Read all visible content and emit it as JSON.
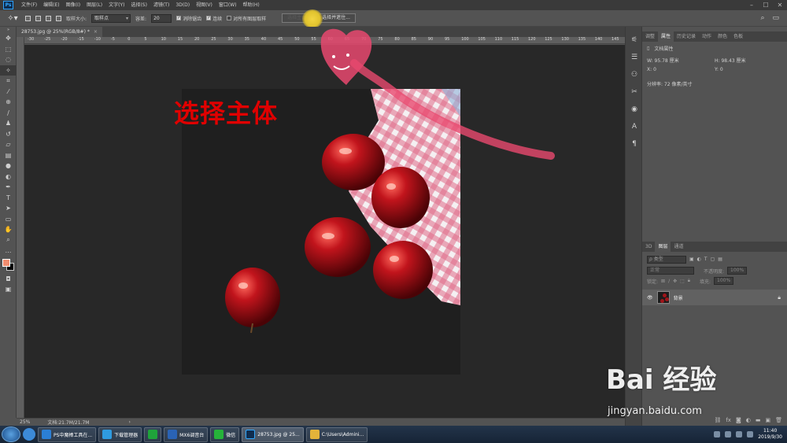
{
  "menubar": {
    "app_badge": "Ps",
    "items": [
      "文件(F)",
      "编辑(E)",
      "图像(I)",
      "图层(L)",
      "文字(Y)",
      "选择(S)",
      "滤镜(T)",
      "3D(D)",
      "视图(V)",
      "窗口(W)",
      "帮助(H)"
    ],
    "window_controls": [
      "–",
      "☐",
      "✕"
    ]
  },
  "options": {
    "sample_size_label": "取样大小:",
    "sample_size_value": "取样点",
    "tolerance_label": "容差:",
    "tolerance_value": "20",
    "antialias_label": "消除锯齿",
    "contiguous_label": "连续",
    "sample_all_label": "对所有图层取样",
    "select_subject_label": "选择主体",
    "select_mask_label": "选择并遮住..."
  },
  "document": {
    "tab_title": "28753.jpg @ 25%(RGB/8#) *",
    "close_symbol": "×",
    "ruler_ticks": [
      "-30",
      "-25",
      "-20",
      "-15",
      "-10",
      "-5",
      "0",
      "5",
      "10",
      "15",
      "20",
      "25",
      "30",
      "35",
      "40",
      "45",
      "50",
      "55",
      "60",
      "65",
      "70",
      "75",
      "80",
      "85",
      "90",
      "95",
      "100",
      "105",
      "110",
      "115",
      "120",
      "125",
      "130",
      "135",
      "140",
      "145"
    ],
    "overlay_text": "选择主体"
  },
  "status": {
    "zoom": "25%",
    "doc_info": "文档:21.7M/21.7M",
    "arrow": "›"
  },
  "properties_panel": {
    "tabs": [
      "调整",
      "属性",
      "历史记录",
      "动作",
      "颜色",
      "色板"
    ],
    "active_tab": "属性",
    "section_title": "文档属性",
    "w_label": "W:",
    "w_value": "95.78 厘米",
    "h_label": "H:",
    "h_value": "98.43 厘米",
    "x_label": "X:",
    "x_value": "0",
    "y_label": "Y:",
    "y_value": "0",
    "resolution": "分辨率: 72 像素/英寸"
  },
  "layers_panel": {
    "tabs": [
      "3D",
      "图层",
      "通道"
    ],
    "active_tab": "图层",
    "filter_placeholder": "ρ 类型",
    "blend_mode": "正常",
    "opacity_label": "不透明度:",
    "opacity_value": "100%",
    "lock_label": "锁定:",
    "fill_label": "填充:",
    "fill_value": "100%",
    "layer_name": "背景"
  },
  "taskbar": {
    "items": [
      {
        "label": "PS中魔棒工具在...",
        "color": "#2b7fd6"
      },
      {
        "label": "下载管理器",
        "color": "#2f9be0"
      },
      {
        "label": "",
        "color": "#1fa33b"
      },
      {
        "label": "MX6调音台",
        "color": "#2a63b5"
      },
      {
        "label": "微信",
        "color": "#26b33a"
      },
      {
        "label": "28753.jpg @ 25...",
        "color": "#0f2d4f"
      },
      {
        "label": "C:\\Users\\Admini...",
        "color": "#e3b33a"
      }
    ],
    "time": "11:40",
    "date": "2019/9/30"
  },
  "watermark": {
    "main": "Bai 经验",
    "sub": "jingyan.baidu.com"
  },
  "colors": {
    "foreground": "#f28d70",
    "background": "#000000",
    "overlay_text": "#e00000",
    "annotation_arrow": "#e8486e",
    "highlight": "#f2d541"
  }
}
